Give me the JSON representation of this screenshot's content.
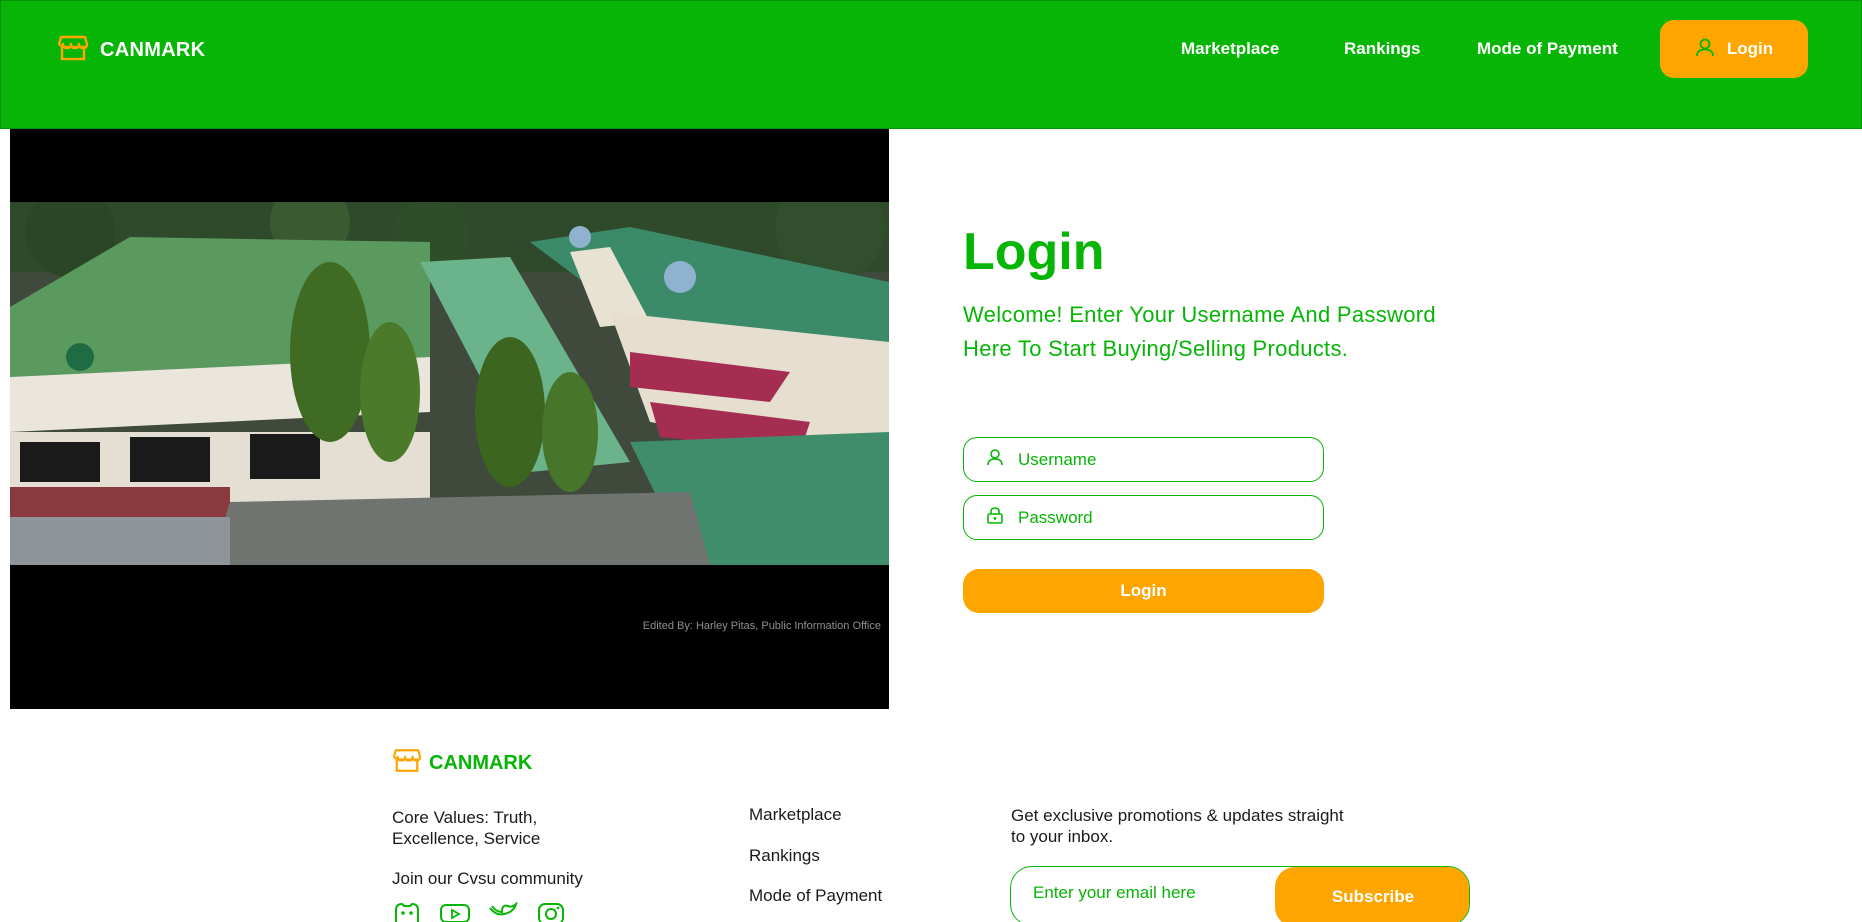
{
  "header": {
    "brand": "CANMARK",
    "nav": [
      {
        "label": "Marketplace"
      },
      {
        "label": "Rankings"
      },
      {
        "label": "Mode of Payment"
      }
    ],
    "login_button": "Login"
  },
  "hero": {
    "photo_credit": "Edited By: Harley Pitas, Public Information Office"
  },
  "login": {
    "title": "Login",
    "subtitle": "Welcome! Enter Your Username And Password Here To Start Buying/Selling Products.",
    "username_placeholder": "Username",
    "password_placeholder": "Password",
    "submit": "Login"
  },
  "footer": {
    "brand": "CANMARK",
    "core_values": "Core Values: Truth, Excellence, Service",
    "join": "Join our Cvsu community",
    "links": [
      {
        "label": "Marketplace"
      },
      {
        "label": "Rankings"
      },
      {
        "label": "Mode of Payment"
      }
    ],
    "promo": "Get exclusive promotions & updates straight to your inbox.",
    "email_placeholder": "Enter your email here",
    "subscribe": "Subscribe"
  },
  "colors": {
    "primary_green": "#07b507",
    "accent_orange": "#ffa500"
  },
  "icons": [
    "store-icon",
    "user-icon",
    "lock-icon",
    "discord-icon",
    "youtube-icon",
    "twitter-icon",
    "instagram-icon"
  ]
}
